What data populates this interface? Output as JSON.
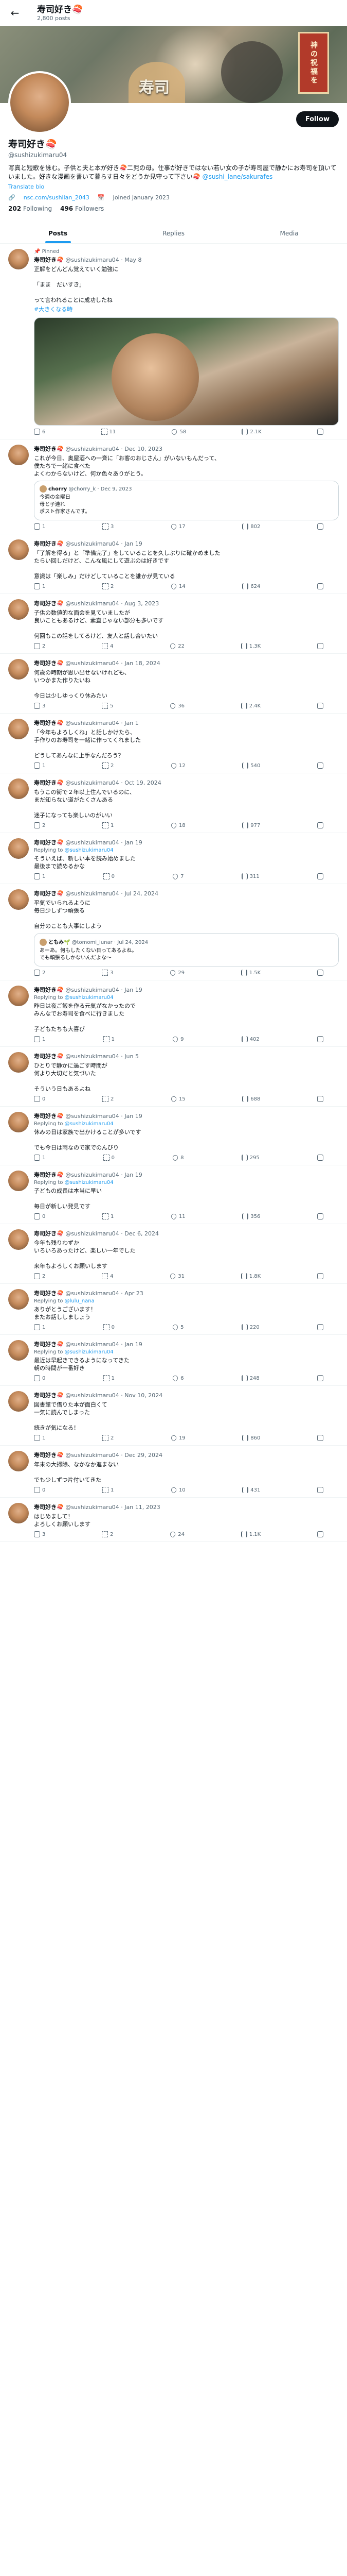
{
  "header": {
    "title": "寿司好き🍣",
    "subtitle": "2,800 posts"
  },
  "banner": {
    "sign": "寿司",
    "seal": "神の祝福を"
  },
  "profile": {
    "name": "寿司好き🍣",
    "handle": "@sushizukimaru04",
    "follow_label": "Follow",
    "bio": "写真と短歌を詠む。子供と夫と本が好き🍣二児の母。仕事が好きではない若い女の子が寿司屋で静かにお寿司を頂いていました。好きな漫画を書いて暮らす日々をどうか見守って下さい🍣",
    "bio_link": "@sushi_lane/sakurafes",
    "translate": "Translate bio",
    "location": "nsc.com/sushilan_2043",
    "joined": "Joined January 2023",
    "following_count": "202",
    "following_label": "Following",
    "followers_count": "496",
    "followers_label": "Followers"
  },
  "tabs": [
    "Posts",
    "Replies",
    "Media"
  ],
  "tweets": [
    {
      "pinned": "📌 Pinned",
      "name": "寿司好き🍣",
      "meta": "@sushizukimaru04 · May 8",
      "text": "正解をどんどん覚えていく勉強に\n\n「まま　だいすき」\n\nって言われることに成功したね",
      "hashtag": "#大きくなる時",
      "media": true,
      "stats": [
        "6",
        "11",
        "58",
        "2.1K"
      ]
    },
    {
      "name": "寿司好き🍣",
      "meta": "@sushizukimaru04 · Dec 10, 2023",
      "text": "これが今日、奥屋酒への一斉に「お客のおじさん」がいないもんだって、\n僕たちで一緒に食べた\nよくわからないけど、何か色々ありがとう。",
      "quote": {
        "name": "chorry",
        "meta": "@chorry_k · Dec 9, 2023",
        "text": "今週の金曜日\n母と子連れ\nポスト作家さんです。"
      },
      "stats": [
        "1",
        "3",
        "17",
        "802"
      ]
    },
    {
      "name": "寿司好き🍣",
      "meta": "@sushizukimaru04 · Jan 19",
      "text": "「了解を得る」と「準備完了」をしていることを久しぶりに確かめました\nたらい回しだけど、こんな風にして遊ぶのは好きです\n\n意識は「楽しみ」だけどしていることを誰かが見ている",
      "stats": [
        "1",
        "2",
        "14",
        "624"
      ]
    },
    {
      "name": "寿司好き🍣",
      "meta": "@sushizukimaru04 · Aug 3, 2023",
      "text": "子供の数値的な面会を見ていましたが\n良いこともあるけど、素直じゃない部分も多いです\n\n何回もこの話をしてるけど、友人と話し合いたい",
      "stats": [
        "2",
        "4",
        "22",
        "1.3K"
      ]
    },
    {
      "name": "寿司好き🍣",
      "meta": "@sushizukimaru04 · Jan 18, 2024",
      "text": "何歳の時期が思い出せないけれども、\nいつかまた作りたいね\n\n今日は少しゆっくり休みたい",
      "stats": [
        "3",
        "5",
        "36",
        "2.4K"
      ]
    },
    {
      "name": "寿司好き🍣",
      "meta": "@sushizukimaru04 · Jan 1",
      "text": "「今年もよろしくね」と話しかけたら、\n手作りのお寿司を一緒に作ってくれました\n\nどうしてあんなに上手なんだろう？",
      "stats": [
        "1",
        "2",
        "12",
        "540"
      ]
    },
    {
      "name": "寿司好き🍣",
      "meta": "@sushizukimaru04 · Oct 19, 2024",
      "text": "もうこの街で２年以上住んでいるのに、\nまだ知らない道がたくさんある\n\n迷子になっても楽しいのがいい",
      "stats": [
        "2",
        "1",
        "18",
        "977"
      ]
    },
    {
      "name": "寿司好き🍣",
      "meta": "@sushizukimaru04 · Jan 19",
      "replying": "@sushizukimaru04",
      "text": "そういえば、新しい本を読み始めました\n最後まで読めるかな",
      "stats": [
        "1",
        "0",
        "7",
        "311"
      ]
    },
    {
      "name": "寿司好き🍣",
      "meta": "@sushizukimaru04 · Jul 24, 2024",
      "text": "平気でいられるように\n毎日少しずつ頑張る\n\n自分のことも大事にしよう",
      "quote": {
        "name": "ともみ🌱",
        "meta": "@tomomi_lunar · Jul 24, 2024",
        "text": "あーあ。何もしたくない日ってあるよね。\nでも頑張るしかないんだよな〜"
      },
      "stats": [
        "2",
        "3",
        "29",
        "1.5K"
      ]
    },
    {
      "name": "寿司好き🍣",
      "meta": "@sushizukimaru04 · Jan 19",
      "replying": "@sushizukimaru04",
      "text": "昨日は夜ご飯を作る元気がなかったので\nみんなでお寿司を食べに行きました\n\n子どもたちも大喜び",
      "stats": [
        "1",
        "1",
        "9",
        "402"
      ]
    },
    {
      "name": "寿司好き🍣",
      "meta": "@sushizukimaru04 · Jun 5",
      "text": "ひとりで静かに過ごす時間が\n何より大切だと気づいた\n\nそういう日もあるよね",
      "stats": [
        "0",
        "2",
        "15",
        "688"
      ]
    },
    {
      "name": "寿司好き🍣",
      "meta": "@sushizukimaru04 · Jan 19",
      "replying": "@sushizukimaru04",
      "text": "休みの日は家族で出かけることが多いです\n\nでも今日は雨なので家でのんびり",
      "stats": [
        "1",
        "0",
        "8",
        "295"
      ]
    },
    {
      "name": "寿司好き🍣",
      "meta": "@sushizukimaru04 · Jan 19",
      "replying": "@sushizukimaru04",
      "text": "子どもの成長は本当に早い\n\n毎日が新しい発見です",
      "stats": [
        "0",
        "1",
        "11",
        "356"
      ]
    },
    {
      "name": "寿司好き🍣",
      "meta": "@sushizukimaru04 · Dec 6, 2024",
      "text": "今年も残りわずか\nいろいろあったけど、楽しい一年でした\n\n来年もよろしくお願いします",
      "stats": [
        "2",
        "4",
        "31",
        "1.8K"
      ]
    },
    {
      "name": "寿司好き🍣",
      "meta": "@sushizukimaru04 · Apr 23",
      "replying": "@lulu_nana",
      "text": "ありがとうございます！\nまたお話ししましょう",
      "stats": [
        "1",
        "0",
        "5",
        "220"
      ]
    },
    {
      "name": "寿司好き🍣",
      "meta": "@sushizukimaru04 · Jan 19",
      "replying": "@sushizukimaru04",
      "text": "最近は早起きできるようになってきた\n朝の時間が一番好き",
      "stats": [
        "0",
        "1",
        "6",
        "248"
      ]
    },
    {
      "name": "寿司好き🍣",
      "meta": "@sushizukimaru04 · Nov 10, 2024",
      "text": "図書館で借りた本が面白くて\n一気に読んでしまった\n\n続きが気になる！",
      "stats": [
        "1",
        "2",
        "19",
        "860"
      ]
    },
    {
      "name": "寿司好き🍣",
      "meta": "@sushizukimaru04 · Dec 29, 2024",
      "text": "年末の大掃除、なかなか進まない\n\nでも少しずつ片付いてきた",
      "stats": [
        "0",
        "1",
        "10",
        "431"
      ]
    },
    {
      "name": "寿司好き🍣",
      "meta": "@sushizukimaru04 · Jan 11, 2023",
      "text": "はじめまして！\nよろしくお願いします",
      "stats": [
        "3",
        "2",
        "24",
        "1.1K"
      ]
    }
  ]
}
